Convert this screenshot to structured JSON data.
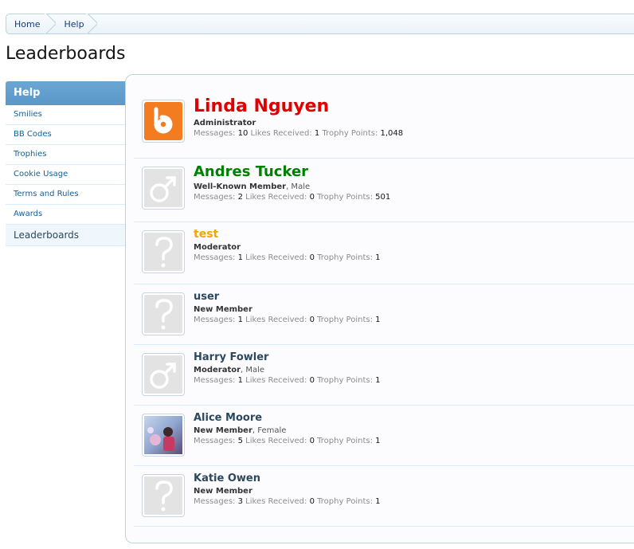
{
  "breadcrumb": {
    "items": [
      "Home",
      "Help"
    ]
  },
  "page": {
    "title": "Leaderboards"
  },
  "sidebar": {
    "header": "Help",
    "items": [
      {
        "label": "Smilies"
      },
      {
        "label": "BB Codes"
      },
      {
        "label": "Trophies"
      },
      {
        "label": "Cookie Usage"
      },
      {
        "label": "Terms and Rules"
      },
      {
        "label": "Awards"
      },
      {
        "label": "Leaderboards",
        "active": true
      }
    ]
  },
  "labels": {
    "messages": "Messages:",
    "likes": "Likes Received:",
    "trophy": "Trophy Points:"
  },
  "members": [
    {
      "name": "Linda Nguyen",
      "color": "#e00000",
      "title": "Administrator",
      "extra": "",
      "messages": "10",
      "likes": "1",
      "trophy": "1,048",
      "avatar": "b-logo-icon"
    },
    {
      "name": "Andres Tucker",
      "color": "#008000",
      "title": "Well-Known Member",
      "extra": ", Male",
      "messages": "2",
      "likes": "0",
      "trophy": "501",
      "avatar": "male-symbol-icon"
    },
    {
      "name": "test",
      "color": "#f0a800",
      "title": "Moderator",
      "extra": "",
      "messages": "1",
      "likes": "0",
      "trophy": "1",
      "avatar": "question-mark-icon"
    },
    {
      "name": "user",
      "color": "#2b485c",
      "title": "New Member",
      "extra": "",
      "messages": "1",
      "likes": "0",
      "trophy": "1",
      "avatar": "question-mark-icon"
    },
    {
      "name": "Harry Fowler",
      "color": "#2b485c",
      "title": "Moderator",
      "extra": ", Male",
      "messages": "1",
      "likes": "0",
      "trophy": "1",
      "avatar": "male-symbol-icon"
    },
    {
      "name": "Alice Moore",
      "color": "#2b485c",
      "title": "New Member",
      "extra": ", Female",
      "messages": "5",
      "likes": "0",
      "trophy": "1",
      "avatar": "photo-avatar"
    },
    {
      "name": "Katie Owen",
      "color": "#2b485c",
      "title": "New Member",
      "extra": "",
      "messages": "3",
      "likes": "0",
      "trophy": "1",
      "avatar": "question-mark-icon"
    }
  ]
}
